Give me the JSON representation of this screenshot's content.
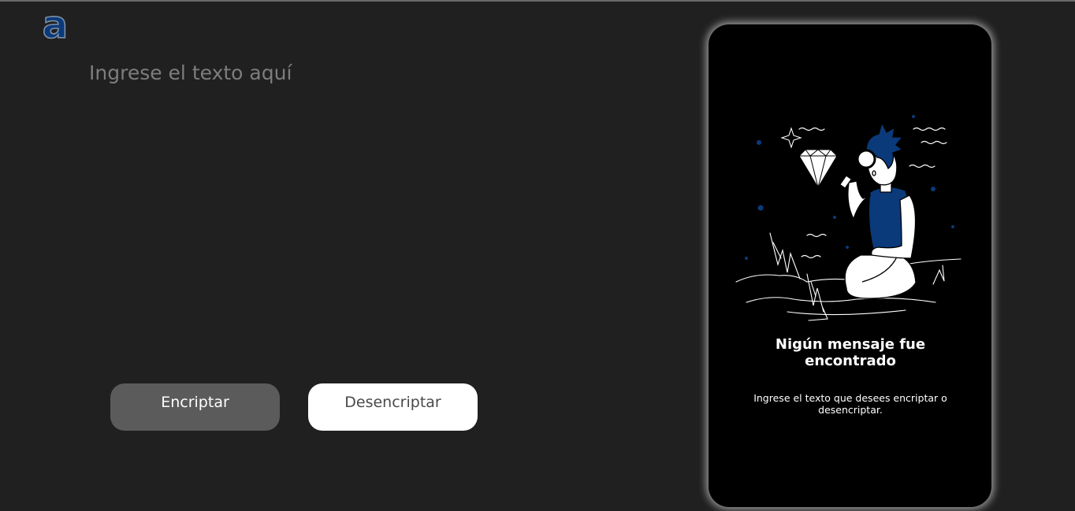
{
  "logo": {
    "letter": "a",
    "icon": "logo-a-icon"
  },
  "input": {
    "placeholder": "Ingrese el texto aquí",
    "value": ""
  },
  "buttons": {
    "encrypt_label": "Encriptar",
    "decrypt_label": "Desencriptar"
  },
  "result_panel": {
    "illustration": "person-with-magnifier-diamond-illustration",
    "title": "Nigún mensaje fue encontrado",
    "subtitle": "Ingrese el texto que desees encriptar o desencriptar."
  },
  "colors": {
    "background": "#202020",
    "accent": "#0a3a7a",
    "encrypt_button": "#5b5b5b",
    "decrypt_button": "#ffffff",
    "panel": "#000000"
  }
}
